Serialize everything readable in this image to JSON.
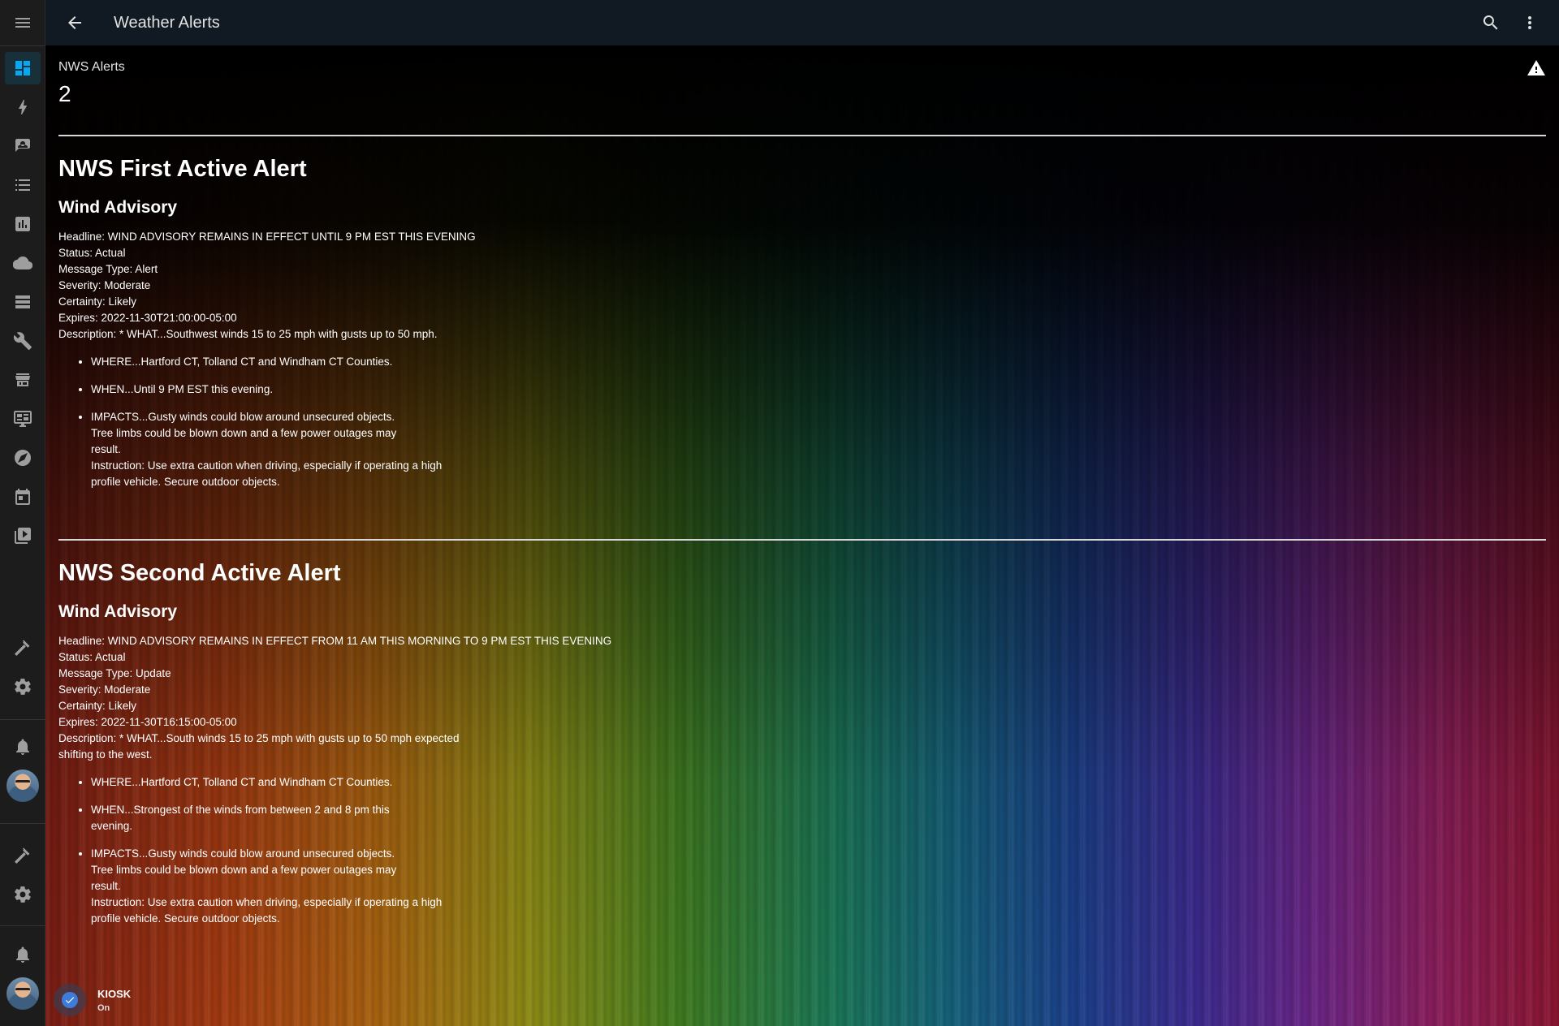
{
  "header": {
    "title": "Weather Alerts",
    "menu_icon": "menu-icon",
    "back_icon": "arrow-left-icon",
    "search_icon": "search-icon",
    "more_icon": "dots-vertical-icon"
  },
  "sidebar": {
    "items": [
      {
        "icon": "dashboard-icon",
        "active": true
      },
      {
        "icon": "lightning-icon"
      },
      {
        "icon": "account-box-icon"
      },
      {
        "icon": "list-icon"
      },
      {
        "icon": "chart-bar-icon"
      },
      {
        "icon": "cloud-icon"
      },
      {
        "icon": "server-icon"
      },
      {
        "icon": "wrench-icon"
      },
      {
        "icon": "store-hacs-icon"
      },
      {
        "icon": "monitor-dashboard-icon"
      },
      {
        "icon": "compass-icon"
      },
      {
        "icon": "calendar-icon"
      },
      {
        "icon": "media-icon"
      }
    ],
    "bottom_items": [
      {
        "icon": "hammer-icon"
      },
      {
        "icon": "cog-icon"
      },
      {
        "icon": "bell-icon"
      },
      {
        "icon": "user-avatar"
      },
      {
        "icon": "hammer-icon"
      },
      {
        "icon": "cog-icon"
      },
      {
        "icon": "bell-icon"
      },
      {
        "icon": "user-avatar"
      }
    ]
  },
  "entity": {
    "name": "NWS Alerts",
    "value": "2",
    "icon": "alert-icon"
  },
  "alerts": [
    {
      "heading": "NWS First Active Alert",
      "event": "Wind Advisory",
      "headline": "Headline: WIND ADVISORY REMAINS IN EFFECT UNTIL 9 PM EST THIS EVENING",
      "status": "Status: Actual",
      "message_type": "Message Type: Alert",
      "severity": "Severity: Moderate",
      "certainty": "Certainty: Likely",
      "expires": "Expires: 2022-11-30T21:00:00-05:00",
      "description": "Description: * WHAT...Southwest winds 15 to 25 mph with gusts up to 50 mph.",
      "bullets": [
        "WHERE...Hartford CT, Tolland CT and Windham CT Counties.",
        "WHEN...Until 9 PM EST this evening.",
        "IMPACTS...Gusty winds could blow around unsecured objects.\nTree limbs could be blown down and a few power outages may\nresult.\nInstruction: Use extra caution when driving, especially if operating a high\nprofile vehicle. Secure outdoor objects."
      ]
    },
    {
      "heading": "NWS Second Active Alert",
      "event": "Wind Advisory",
      "headline": "Headline: WIND ADVISORY REMAINS IN EFFECT FROM 11 AM THIS MORNING TO 9 PM EST THIS EVENING",
      "status": "Status: Actual",
      "message_type": "Message Type: Update",
      "severity": "Severity: Moderate",
      "certainty": "Certainty: Likely",
      "expires": "Expires: 2022-11-30T16:15:00-05:00",
      "description": "Description: * WHAT...South winds 15 to 25 mph with gusts up to 50 mph expected shifting to the west.",
      "bullets": [
        "WHERE...Hartford CT, Tolland CT and Windham CT Counties.",
        "WHEN...Strongest of the winds from between 2 and 8 pm this\nevening.",
        "IMPACTS...Gusty winds could blow around unsecured objects.\nTree limbs could be blown down and a few power outages may\nresult.\nInstruction: Use extra caution when driving, especially if operating a high\nprofile vehicle. Secure outdoor objects."
      ]
    }
  ],
  "kiosk": {
    "name": "KIOSK",
    "state": "On",
    "icon": "check-circle-icon"
  },
  "colors": {
    "accent": "#03a9f4",
    "sidebar_bg": "#1c1c1c",
    "header_bg": "#111a22"
  }
}
